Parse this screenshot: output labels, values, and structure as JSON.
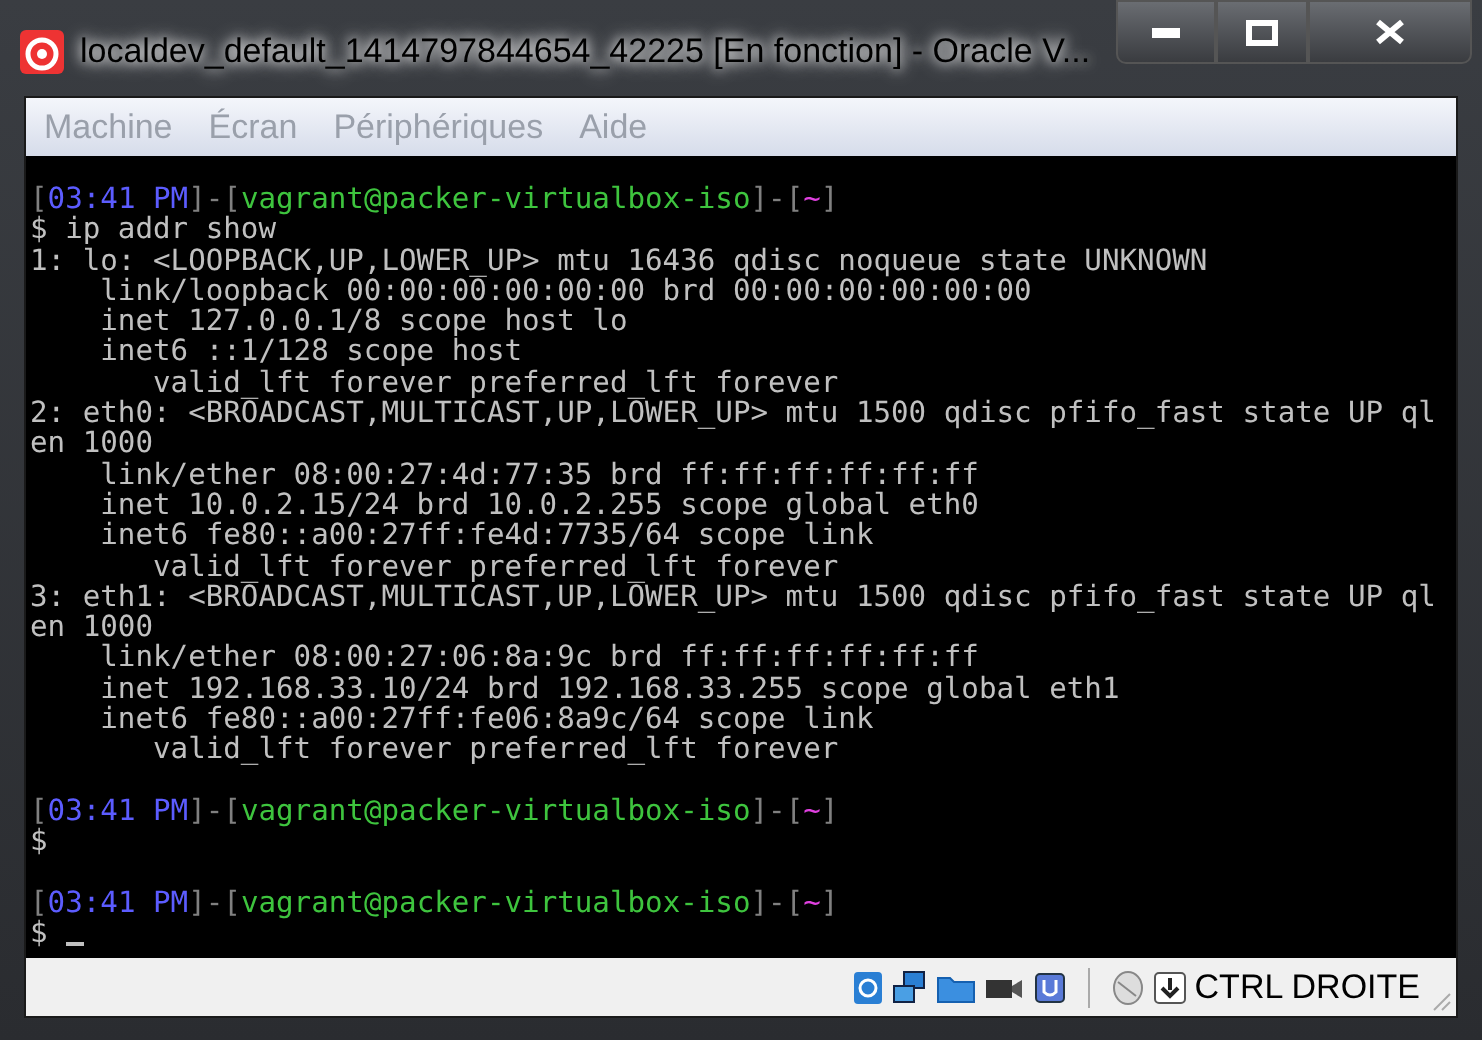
{
  "window": {
    "title": "localdev_default_1414797844654_42225 [En fonction] - Oracle V..."
  },
  "menu": [
    {
      "label": "Machine",
      "disabled": true
    },
    {
      "label": "Écran",
      "disabled": true
    },
    {
      "label": "Périphériques",
      "disabled": true
    },
    {
      "label": "Aide",
      "disabled": true
    }
  ],
  "terminal": {
    "lines": [
      {
        "kind": "prompt",
        "segments": [
          {
            "text": "[",
            "color": "#808080"
          },
          {
            "text": "03:41 PM",
            "color": "#5c5cff"
          },
          {
            "text": "]-[",
            "color": "#808080"
          },
          {
            "text": "vagrant@packer-virtualbox-iso",
            "color": "#3ec43e"
          },
          {
            "text": "]-[",
            "color": "#808080"
          },
          {
            "text": "~",
            "color": "#e040e0"
          },
          {
            "text": "]",
            "color": "#808080"
          }
        ]
      },
      {
        "kind": "text",
        "text": "$ ip addr show"
      },
      {
        "kind": "text",
        "text": "1: lo: <LOOPBACK,UP,LOWER_UP> mtu 16436 qdisc noqueue state UNKNOWN"
      },
      {
        "kind": "text",
        "text": "    link/loopback 00:00:00:00:00:00 brd 00:00:00:00:00:00"
      },
      {
        "kind": "text",
        "text": "    inet 127.0.0.1/8 scope host lo"
      },
      {
        "kind": "text",
        "text": "    inet6 ::1/128 scope host"
      },
      {
        "kind": "text",
        "text": "       valid_lft forever preferred_lft forever"
      },
      {
        "kind": "text",
        "text": "2: eth0: <BROADCAST,MULTICAST,UP,LOWER_UP> mtu 1500 qdisc pfifo_fast state UP ql"
      },
      {
        "kind": "text",
        "text": "en 1000"
      },
      {
        "kind": "text",
        "text": "    link/ether 08:00:27:4d:77:35 brd ff:ff:ff:ff:ff:ff"
      },
      {
        "kind": "text",
        "text": "    inet 10.0.2.15/24 brd 10.0.2.255 scope global eth0"
      },
      {
        "kind": "text",
        "text": "    inet6 fe80::a00:27ff:fe4d:7735/64 scope link"
      },
      {
        "kind": "text",
        "text": "       valid_lft forever preferred_lft forever"
      },
      {
        "kind": "text",
        "text": "3: eth1: <BROADCAST,MULTICAST,UP,LOWER_UP> mtu 1500 qdisc pfifo_fast state UP ql"
      },
      {
        "kind": "text",
        "text": "en 1000"
      },
      {
        "kind": "text",
        "text": "    link/ether 08:00:27:06:8a:9c brd ff:ff:ff:ff:ff:ff"
      },
      {
        "kind": "text",
        "text": "    inet 192.168.33.10/24 brd 192.168.33.255 scope global eth1"
      },
      {
        "kind": "text",
        "text": "    inet6 fe80::a00:27ff:fe06:8a9c/64 scope link"
      },
      {
        "kind": "text",
        "text": "       valid_lft forever preferred_lft forever"
      },
      {
        "kind": "blank"
      },
      {
        "kind": "prompt",
        "segments": [
          {
            "text": "[",
            "color": "#808080"
          },
          {
            "text": "03:41 PM",
            "color": "#5c5cff"
          },
          {
            "text": "]-[",
            "color": "#808080"
          },
          {
            "text": "vagrant@packer-virtualbox-iso",
            "color": "#3ec43e"
          },
          {
            "text": "]-[",
            "color": "#808080"
          },
          {
            "text": "~",
            "color": "#e040e0"
          },
          {
            "text": "]",
            "color": "#808080"
          }
        ]
      },
      {
        "kind": "text",
        "text": "$"
      },
      {
        "kind": "blank"
      },
      {
        "kind": "prompt",
        "segments": [
          {
            "text": "[",
            "color": "#808080"
          },
          {
            "text": "03:41 PM",
            "color": "#5c5cff"
          },
          {
            "text": "]-[",
            "color": "#808080"
          },
          {
            "text": "vagrant@packer-virtualbox-iso",
            "color": "#3ec43e"
          },
          {
            "text": "]-[",
            "color": "#808080"
          },
          {
            "text": "~",
            "color": "#e040e0"
          },
          {
            "text": "]",
            "color": "#808080"
          }
        ]
      },
      {
        "kind": "input",
        "text": "$",
        "cursor": true
      }
    ]
  },
  "status_bar": {
    "host_key": "CTRL DROITE"
  }
}
